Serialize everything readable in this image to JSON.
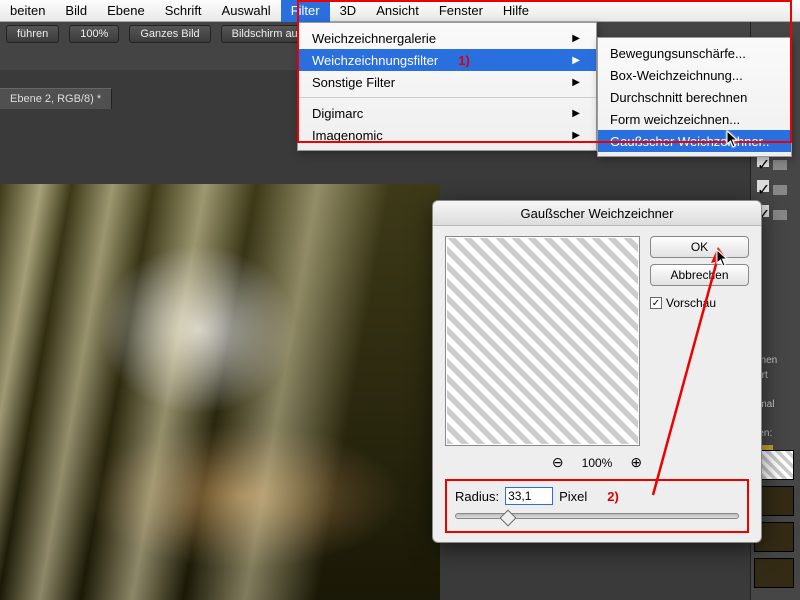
{
  "menubar": {
    "items": [
      "beiten",
      "Bild",
      "Ebene",
      "Schrift",
      "Auswahl",
      "Filter",
      "3D",
      "Ansicht",
      "Fenster",
      "Hilfe"
    ],
    "selected": "Filter"
  },
  "dropdown": {
    "rows": [
      {
        "label": "Weichzeichnergalerie",
        "sub": true
      },
      {
        "label": "Weichzeichnungsfilter",
        "sub": true,
        "selected": true
      },
      {
        "label": "Sonstige Filter",
        "sub": true
      },
      {
        "sep": true
      },
      {
        "label": "Digimarc",
        "sub": true
      },
      {
        "label": "Imagenomic",
        "sub": true
      }
    ],
    "annotation": "1)"
  },
  "submenu": {
    "rows": [
      {
        "label": "Bewegungsunschärfe..."
      },
      {
        "label": "Box-Weichzeichnung..."
      },
      {
        "label": "Durchschnitt berechnen"
      },
      {
        "label": "Form weichzeichnen..."
      },
      {
        "label": "Gaußscher Weichzeichner..",
        "selected": true
      }
    ]
  },
  "optbar": {
    "btn1": "führen",
    "zoom": "100%",
    "btn2": "Ganzes Bild",
    "btn3": "Bildschirm aus"
  },
  "tab": {
    "label": "Ebene 2, RGB/8) *"
  },
  "dialog": {
    "title": "Gaußscher Weichzeichner",
    "ok": "OK",
    "cancel": "Abbrechen",
    "preview": "Vorschau",
    "zoom": "100%",
    "radius_label": "Radius:",
    "radius_value": "33,1",
    "radius_unit": "Pixel",
    "annotation": "2)"
  },
  "rightpanel": {
    "labels": [
      "enen",
      "Art",
      "rmal",
      "ren:"
    ]
  }
}
